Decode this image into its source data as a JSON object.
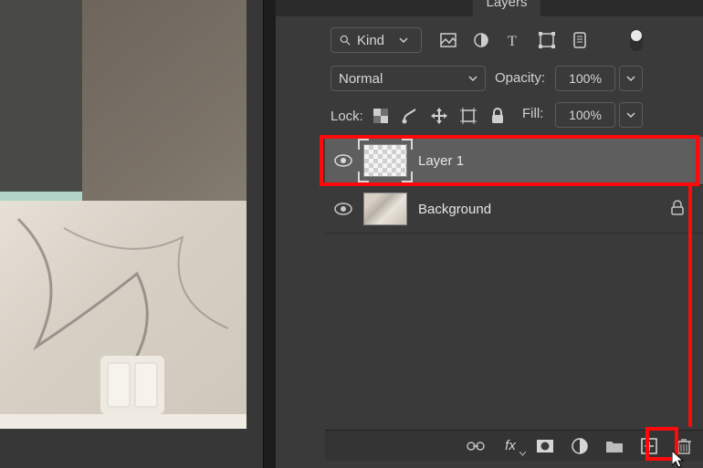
{
  "tabs": {
    "layers": "Layers"
  },
  "filter": {
    "kind": "Kind"
  },
  "blend": {
    "mode": "Normal",
    "opacity_label": "Opacity:",
    "opacity_value": "100%"
  },
  "lock": {
    "label": "Lock:",
    "fill_label": "Fill:",
    "fill_value": "100%"
  },
  "layers": [
    {
      "name": "Layer 1"
    },
    {
      "name": "Background"
    }
  ],
  "bottom_icons": [
    "link",
    "fx",
    "mask",
    "adjust",
    "group",
    "new",
    "trash"
  ],
  "fx_text": "fx"
}
